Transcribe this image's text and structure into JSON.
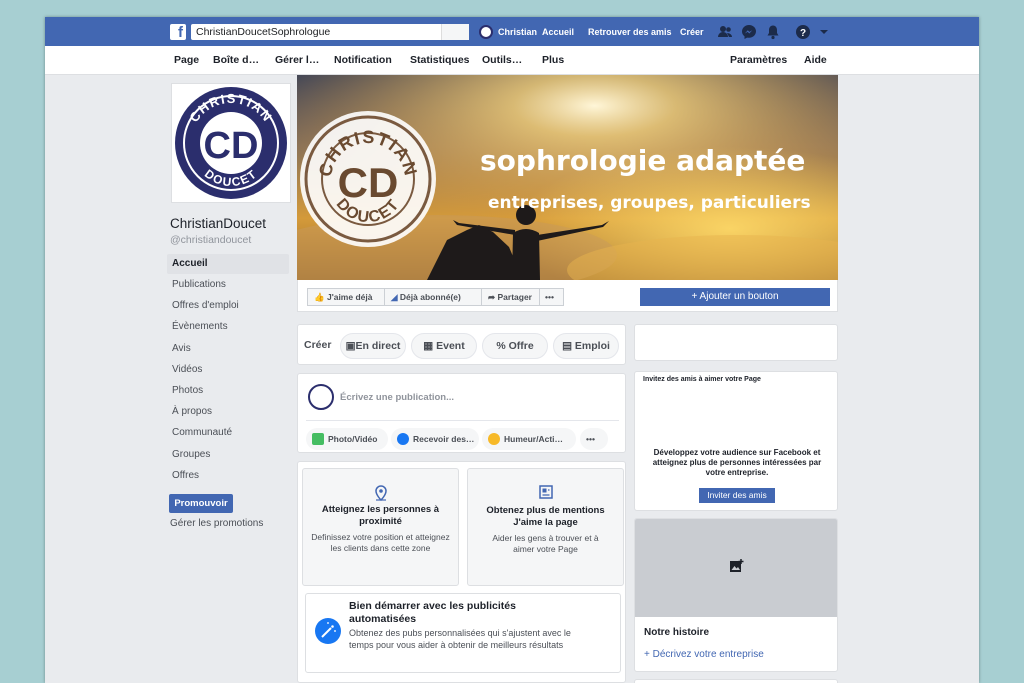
{
  "topbar": {
    "logo_letter": "f",
    "search_value": "ChristianDoucetSophrologue",
    "profile_name": "Christian",
    "links": [
      "Accueil",
      "Retrouver des amis",
      "Créer"
    ],
    "icons": [
      "friends-icon",
      "messenger-icon",
      "bell-icon",
      "help-icon",
      "dropdown-icon"
    ]
  },
  "pagenav": {
    "left": [
      "Page",
      "Boîte d…",
      "Gérer l…",
      "Notification",
      "Statistiques",
      "Outils…",
      "Plus"
    ],
    "right": [
      "Paramètres",
      "Aide"
    ]
  },
  "profile": {
    "logo_top": "CHRISTIAN",
    "logo_bottom": "DOUCET",
    "logo_letters": "CD",
    "name": "ChristianDoucet",
    "handle": "@christiandoucet"
  },
  "sidebar": {
    "items": [
      "Accueil",
      "Publications",
      "Offres d'emploi",
      "Évènements",
      "Avis",
      "Vidéos",
      "Photos",
      "À propos",
      "Communauté",
      "Groupes",
      "Offres"
    ],
    "promote_button": "Promouvoir",
    "manage_promotions": "Gérer les promotions"
  },
  "cover": {
    "headline": "sophrologie adaptée",
    "subline": "entreprises, groupes, particuliers"
  },
  "actions": {
    "like": "J'aime déjà",
    "follow": "Déjà abonné(e)",
    "share": "Partager",
    "more": "•••",
    "add_button": "+ Ajouter un bouton"
  },
  "create": {
    "label": "Créer",
    "options": [
      "En direct",
      "Event",
      "Offre",
      "Emploi"
    ]
  },
  "composer": {
    "placeholder": "Écrivez une publication...",
    "options": [
      "Photo/Vidéo",
      "Recevoir des…",
      "Humeur/Acti…"
    ],
    "more": "•••"
  },
  "tips": [
    {
      "title": "Atteignez les personnes à proximité",
      "desc": "Definissez votre position et atteignez les clients dans cette zone"
    },
    {
      "title": "Obtenez plus de mentions J'aime la page",
      "desc": "Aider les gens à trouver et à aimer votre Page"
    }
  ],
  "ads": {
    "title": "Bien démarrer avec les publicités automatisées",
    "desc": "Obtenez des pubs personnalisées qui s'ajustent avec le temps pour vous aider à obtenir de meilleurs résultats"
  },
  "invite": {
    "title": "Invitez des amis à aimer votre Page",
    "desc": "Développez votre audience sur Facebook et atteignez plus de personnes intéressées par votre entreprise.",
    "button": "Inviter des amis"
  },
  "story": {
    "title": "Notre histoire",
    "link": "+ Décrivez votre entreprise"
  },
  "colors": {
    "brand": "#4267b2",
    "logo_navy": "#2b2e6d",
    "background": "#e9ebee"
  }
}
